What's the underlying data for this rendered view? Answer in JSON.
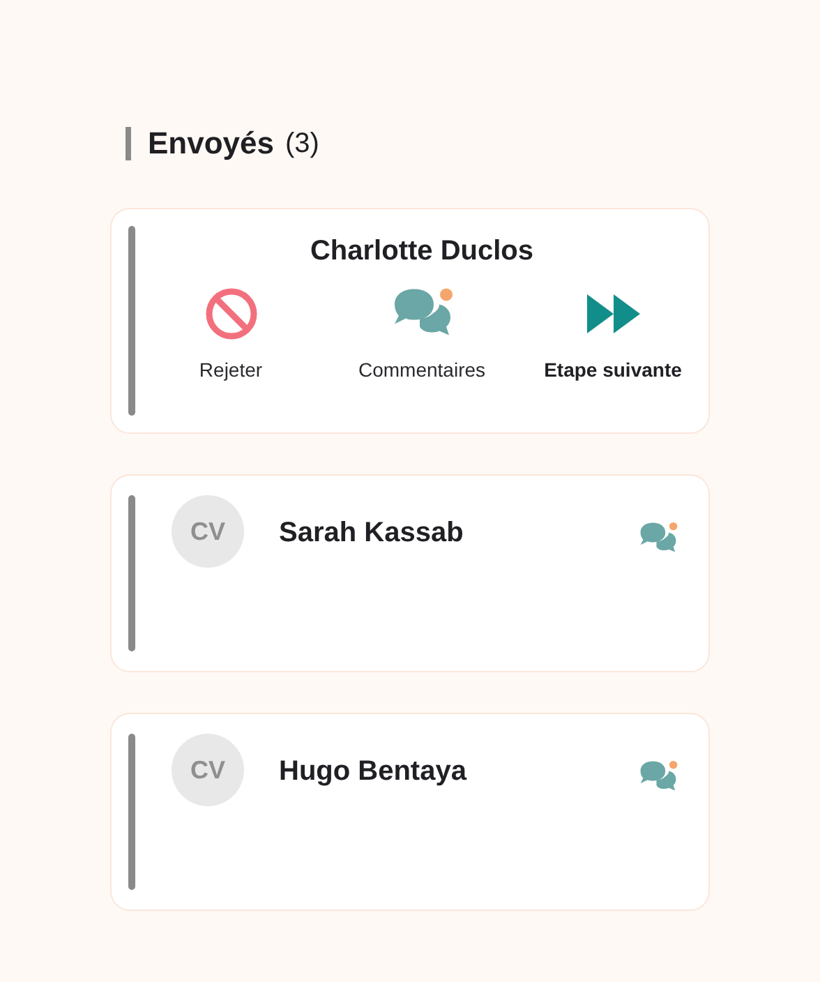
{
  "section": {
    "title": "Envoyés",
    "count": "(3)"
  },
  "cards": [
    {
      "kind": "expanded",
      "name": "Charlotte Duclos",
      "actions": [
        {
          "kind": "reject",
          "label": "Rejeter",
          "emphasized": false
        },
        {
          "kind": "comments",
          "label": "Commentaires",
          "emphasized": false,
          "unread": true
        },
        {
          "kind": "next",
          "label": "Etape suivante",
          "emphasized": true
        }
      ]
    },
    {
      "kind": "collapsed",
      "name": "Sarah Kassab",
      "avatar": "CV",
      "unread": true
    },
    {
      "kind": "collapsed",
      "name": "Hugo Bentaya",
      "avatar": "CV",
      "unread": true
    }
  ]
}
